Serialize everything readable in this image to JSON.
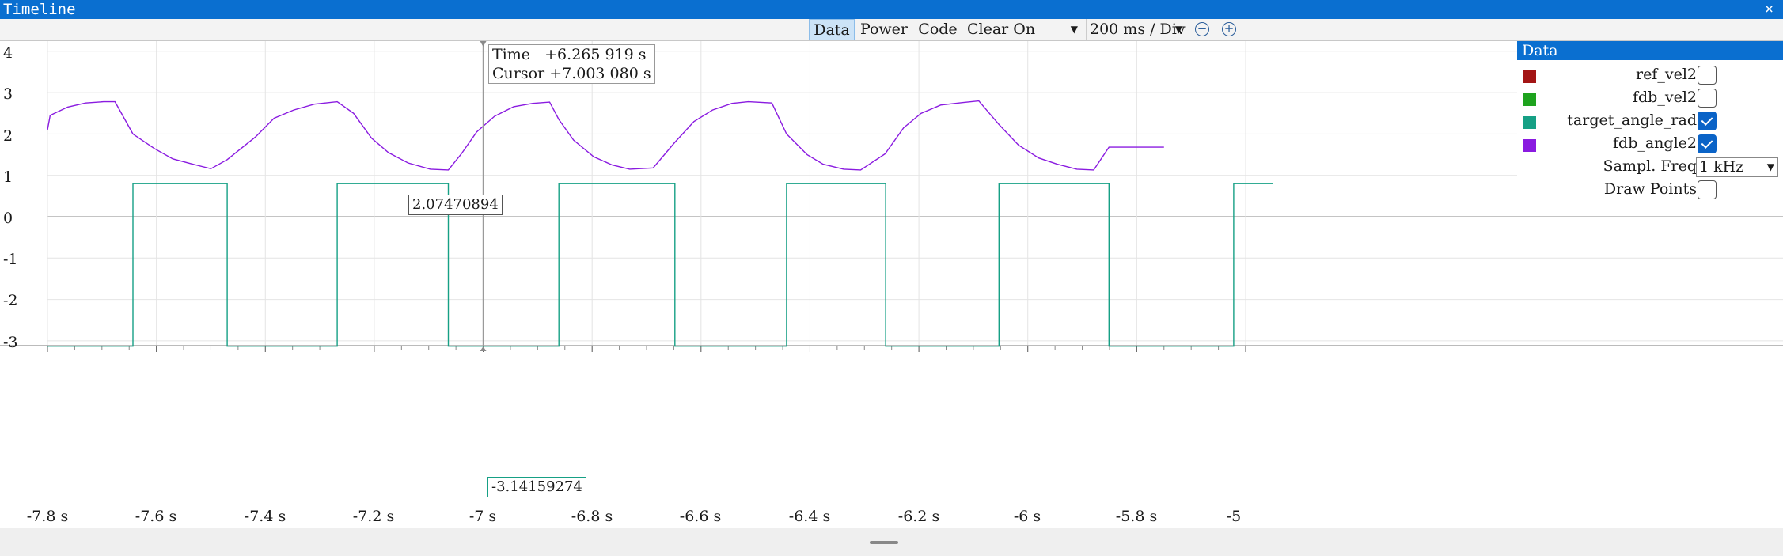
{
  "window": {
    "title": "Timeline",
    "close_glyph": "×"
  },
  "toolbar": {
    "tabs": [
      {
        "label": "Data",
        "active": true
      },
      {
        "label": "Power",
        "active": false
      },
      {
        "label": "Code",
        "active": false
      }
    ],
    "reset_mode": "Clear On Reset",
    "time_scale": "200 ms / Div",
    "zoom_out_icon": "zoom-out-icon",
    "zoom_in_icon": "zoom-in-icon"
  },
  "cursor_info": {
    "time_label": "Time",
    "time_value": "+6.265 919 s",
    "cursor_label": "Cursor",
    "cursor_value": "+7.003 080 s",
    "upper_value": "2.07470894",
    "lower_value": "-3.14159274"
  },
  "panel": {
    "title": "Data",
    "signals": [
      {
        "name": "ref_vel2",
        "color": "#a31515",
        "checked": false
      },
      {
        "name": "fdb_vel2",
        "color": "#1ea31e",
        "checked": false
      },
      {
        "name": "target_angle_rad",
        "color": "#16a085",
        "checked": true
      },
      {
        "name": "fdb_angle2",
        "color": "#8a1be0",
        "checked": true
      }
    ],
    "sample_freq_label": "Sampl. Freq",
    "sample_freq_value": "1 kHz",
    "draw_points_label": "Draw Points",
    "draw_points_checked": false
  },
  "chart_data": {
    "type": "line",
    "title": "",
    "xlabel": "",
    "ylabel": "",
    "xlim": [
      -7.8,
      -5.6
    ],
    "ylim": [
      -3.3,
      4.6
    ],
    "x_tick_labels": [
      "-7.8 s",
      "-7.6 s",
      "-7.4 s",
      "-7.2 s",
      "-7 s",
      "-6.8 s",
      "-6.6 s",
      "-6.4 s",
      "-6.2 s",
      "-6 s",
      "-5.8 s",
      "-5"
    ],
    "x_ticks": [
      -7.8,
      -7.6,
      -7.4,
      -7.2,
      -7.0,
      -6.8,
      -6.6,
      -6.4,
      -6.2,
      -6.0,
      -5.8,
      -5.6
    ],
    "y_tick_labels": [
      "4",
      "3",
      "2",
      "1",
      "0",
      "-1",
      "-2",
      "-3"
    ],
    "y_ticks": [
      4,
      3,
      2,
      1,
      0,
      -1,
      -2,
      -3
    ],
    "grid": true,
    "cursor_x": -7.0,
    "series": [
      {
        "name": "target_angle_rad",
        "color": "#16a085",
        "x": [
          -7.8,
          -7.643,
          -7.643,
          -7.47,
          -7.47,
          -7.268,
          -7.268,
          -7.064,
          -7.064,
          -6.861,
          -6.861,
          -6.648,
          -6.648,
          -6.443,
          -6.443,
          -6.261,
          -6.261,
          -6.053,
          -6.053,
          -5.851,
          -5.851,
          -5.622,
          -5.622,
          -5.55
        ],
        "y": [
          -3.14,
          -3.14,
          0.8,
          0.8,
          -3.14,
          -3.14,
          0.8,
          0.8,
          -3.14,
          -3.14,
          0.8,
          0.8,
          -3.14,
          -3.14,
          0.8,
          0.8,
          -3.14,
          -3.14,
          0.8,
          0.8,
          -3.14,
          -3.14,
          0.8,
          0.8
        ]
      },
      {
        "name": "fdb_angle2",
        "color": "#8a1be0",
        "x": [
          -7.8,
          -7.795,
          -7.763,
          -7.73,
          -7.697,
          -7.676,
          -7.643,
          -7.604,
          -7.57,
          -7.536,
          -7.5,
          -7.47,
          -7.418,
          -7.384,
          -7.348,
          -7.31,
          -7.268,
          -7.238,
          -7.205,
          -7.174,
          -7.138,
          -7.097,
          -7.064,
          -7.04,
          -7.012,
          -6.979,
          -6.944,
          -6.909,
          -6.878,
          -6.861,
          -6.834,
          -6.797,
          -6.763,
          -6.731,
          -6.688,
          -6.648,
          -6.613,
          -6.579,
          -6.543,
          -6.513,
          -6.47,
          -6.443,
          -6.405,
          -6.376,
          -6.338,
          -6.307,
          -6.262,
          -6.228,
          -6.196,
          -6.16,
          -6.12,
          -6.09,
          -6.053,
          -6.017,
          -5.98,
          -5.946,
          -5.91,
          -5.879,
          -5.851,
          -5.75
        ],
        "y": [
          2.1,
          2.45,
          2.65,
          2.75,
          2.78,
          2.78,
          2.0,
          1.65,
          1.4,
          1.28,
          1.16,
          1.38,
          1.93,
          2.38,
          2.58,
          2.72,
          2.78,
          2.5,
          1.9,
          1.55,
          1.3,
          1.15,
          1.13,
          1.52,
          2.05,
          2.43,
          2.66,
          2.74,
          2.77,
          2.35,
          1.85,
          1.45,
          1.25,
          1.15,
          1.18,
          1.8,
          2.3,
          2.58,
          2.74,
          2.78,
          2.75,
          2.0,
          1.5,
          1.27,
          1.15,
          1.13,
          1.52,
          2.15,
          2.5,
          2.7,
          2.76,
          2.8,
          2.23,
          1.73,
          1.42,
          1.27,
          1.15,
          1.13,
          1.68,
          1.68
        ]
      }
    ]
  }
}
